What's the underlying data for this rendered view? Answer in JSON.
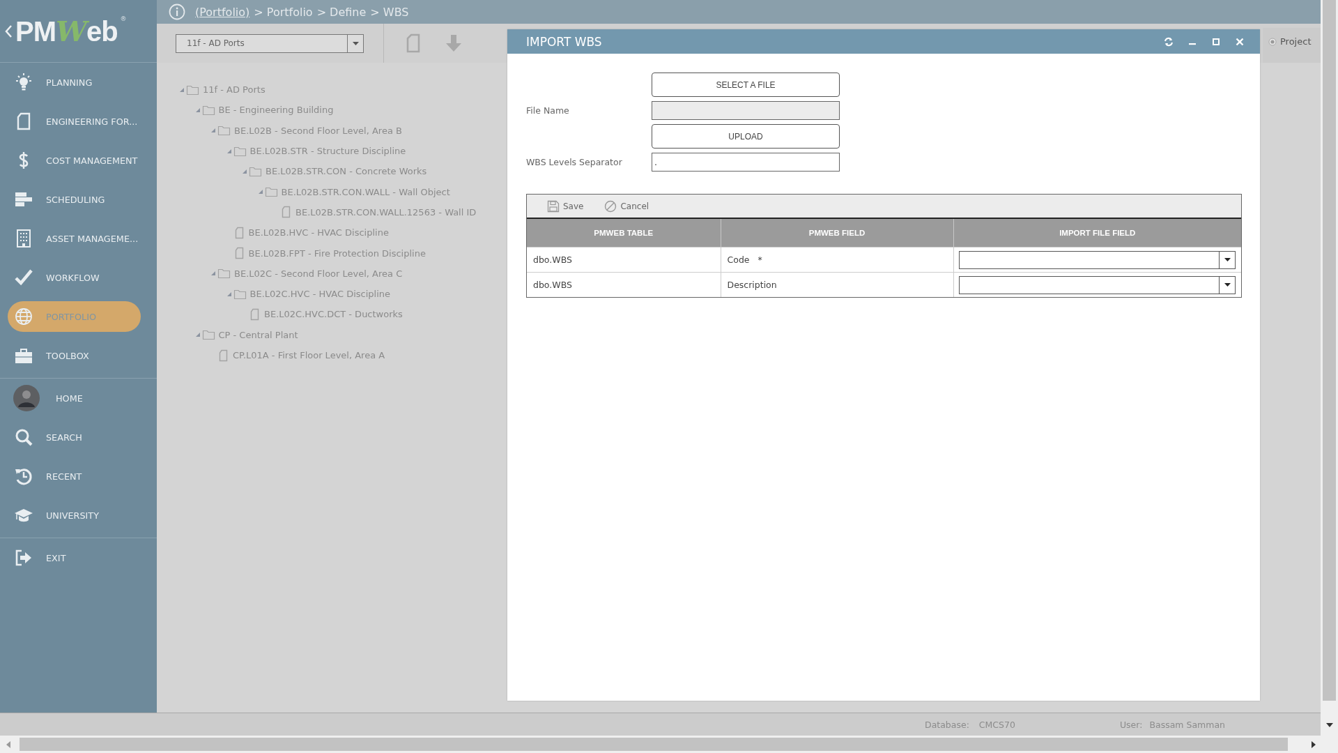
{
  "logo": {
    "prefix": "PM",
    "accent": "W",
    "suffix": "eb",
    "mark": "®"
  },
  "sidebar": {
    "groups": [
      {
        "items": [
          {
            "label": "PLANNING",
            "kind": "nav",
            "selected": false
          },
          {
            "label": "ENGINEERING FOR...",
            "kind": "nav",
            "selected": false
          },
          {
            "label": "COST MANAGEMENT",
            "kind": "nav",
            "selected": false
          },
          {
            "label": "SCHEDULING",
            "kind": "nav",
            "selected": false
          },
          {
            "label": "ASSET MANAGEME...",
            "kind": "nav",
            "selected": false
          },
          {
            "label": "WORKFLOW",
            "kind": "nav",
            "selected": false
          },
          {
            "label": "PORTFOLIO",
            "kind": "nav",
            "selected": true
          },
          {
            "label": "TOOLBOX",
            "kind": "nav",
            "selected": false
          }
        ]
      },
      {
        "items": [
          {
            "label": "HOME",
            "kind": "profile",
            "selected": false
          },
          {
            "label": "SEARCH",
            "kind": "nav",
            "selected": false
          },
          {
            "label": "RECENT",
            "kind": "nav",
            "selected": false
          },
          {
            "label": "UNIVERSITY",
            "kind": "nav",
            "selected": false
          }
        ]
      },
      {
        "items": [
          {
            "label": "EXIT",
            "kind": "nav",
            "selected": false
          }
        ]
      }
    ]
  },
  "breadcrumb": {
    "link": "(Portfolio)",
    "trail": [
      "> Portfolio",
      "> Define",
      "> WBS"
    ]
  },
  "project_selector": {
    "value": "11f - AD Ports"
  },
  "scope_option": {
    "label": "Project",
    "selected": true
  },
  "tree": [
    {
      "label": "11f - AD Ports",
      "kind": "folder",
      "expanded": true,
      "children": [
        {
          "label": "BE - Engineering Building",
          "kind": "folder",
          "expanded": true,
          "children": [
            {
              "label": "BE.L02B - Second Floor Level, Area B",
              "kind": "folder",
              "expanded": true,
              "children": [
                {
                  "label": "BE.L02B.STR - Structure Discipline",
                  "kind": "folder",
                  "expanded": true,
                  "children": [
                    {
                      "label": "BE.L02B.STR.CON - Concrete Works",
                      "kind": "folder",
                      "expanded": true,
                      "children": [
                        {
                          "label": "BE.L02B.STR.CON.WALL - Wall Object",
                          "kind": "folder",
                          "expanded": true,
                          "children": [
                            {
                              "label": "BE.L02B.STR.CON.WALL.12563 - Wall ID",
                              "kind": "item"
                            }
                          ]
                        }
                      ]
                    }
                  ]
                },
                {
                  "label": "BE.L02B.HVC - HVAC Discipline",
                  "kind": "item"
                },
                {
                  "label": "BE.L02B.FPT - Fire Protection Discipline",
                  "kind": "item"
                }
              ]
            },
            {
              "label": "BE.L02C - Second Floor Level, Area C",
              "kind": "folder",
              "expanded": true,
              "children": [
                {
                  "label": "BE.L02C.HVC - HVAC Discipline",
                  "kind": "folder",
                  "expanded": true,
                  "children": [
                    {
                      "label": "BE.L02C.HVC.DCT - Ductworks",
                      "kind": "item"
                    }
                  ]
                }
              ]
            }
          ]
        },
        {
          "label": "CP - Central Plant",
          "kind": "folder",
          "expanded": true,
          "children": [
            {
              "label": "CP.L01A - First Floor Level, Area A",
              "kind": "item"
            }
          ]
        }
      ]
    }
  ],
  "dialog": {
    "title": "IMPORT WBS",
    "select_button": "SELECT A FILE",
    "file_name": {
      "label": "File Name",
      "disabled": true
    },
    "upload_button": "UPLOAD",
    "separator": {
      "label": "WBS Levels Separator",
      "value": "."
    },
    "grid": {
      "toolbar": [
        {
          "label": "Save",
          "kind": "save"
        },
        {
          "label": "Cancel",
          "kind": "cancel"
        }
      ],
      "columns": [
        "PMWEB TABLE",
        "PMWEB FIELD",
        "IMPORT FILE FIELD"
      ],
      "rows": [
        {
          "table": "dbo.WBS",
          "field": "Code",
          "mark": "*"
        },
        {
          "table": "dbo.WBS",
          "field": "Description"
        }
      ]
    }
  },
  "status_bar": {
    "database_label": "Database:",
    "database": "CMCS70",
    "user_label": "User:",
    "user": "Bassam Samman"
  }
}
